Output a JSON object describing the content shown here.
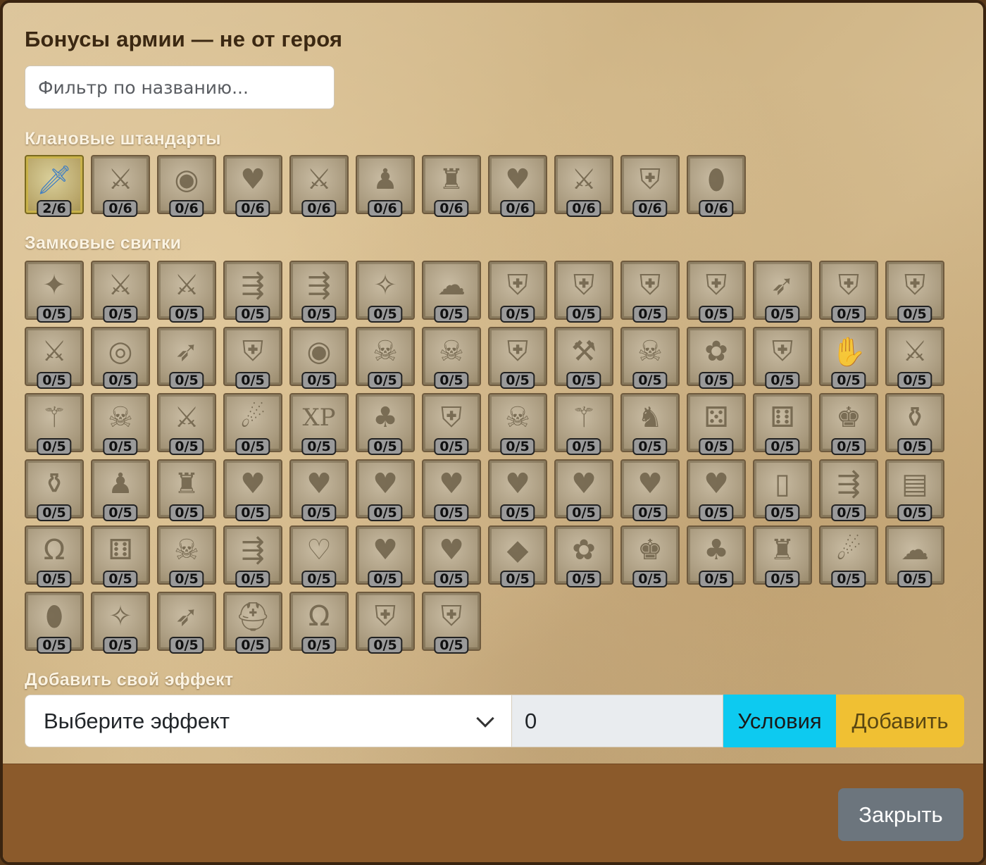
{
  "title": "Бонусы армии — не от героя",
  "filter": {
    "placeholder": "Фильтр по названию..."
  },
  "clan_section": {
    "title": "Клановые штандарты",
    "items": [
      {
        "icon": "sword-icon",
        "glyph": "🗡",
        "count": "2/6",
        "active": true
      },
      {
        "icon": "hand-sword-icon",
        "glyph": "⚔",
        "count": "0/6"
      },
      {
        "icon": "eye-icon",
        "glyph": "◉",
        "count": "0/6"
      },
      {
        "icon": "heart-sword-icon",
        "glyph": "♥",
        "count": "0/6"
      },
      {
        "icon": "crossed-swords-icon",
        "glyph": "⚔",
        "count": "0/6"
      },
      {
        "icon": "pawn-icon",
        "glyph": "♟",
        "count": "0/6"
      },
      {
        "icon": "tower-icon",
        "glyph": "♜",
        "count": "0/6"
      },
      {
        "icon": "heart-icon",
        "glyph": "♥",
        "count": "0/6"
      },
      {
        "icon": "sword-up-icon",
        "glyph": "⚔",
        "count": "0/6"
      },
      {
        "icon": "shield-up-icon",
        "glyph": "⛨",
        "count": "0/6"
      },
      {
        "icon": "egg-icon",
        "glyph": "⬮",
        "count": "0/6"
      }
    ]
  },
  "castle_section": {
    "title": "Замковые свитки",
    "items": [
      {
        "icon": "flock-icon",
        "glyph": "✦",
        "count": "0/5"
      },
      {
        "icon": "archer-icon",
        "glyph": "⚔",
        "count": "0/5"
      },
      {
        "icon": "blade-icon",
        "glyph": "⚔",
        "count": "0/5"
      },
      {
        "icon": "runner-icon",
        "glyph": "⇶",
        "count": "0/5"
      },
      {
        "icon": "soldier-icon",
        "glyph": "⇶",
        "count": "0/5"
      },
      {
        "icon": "wing-icon",
        "glyph": "✧",
        "count": "0/5"
      },
      {
        "icon": "cloud-icon",
        "glyph": "☁",
        "count": "0/5"
      },
      {
        "icon": "wing-shield-icon",
        "glyph": "⛨",
        "count": "0/5"
      },
      {
        "icon": "crowd-shield-icon",
        "glyph": "⛨",
        "count": "0/5"
      },
      {
        "icon": "fist-shield-icon",
        "glyph": "⛨",
        "count": "0/5"
      },
      {
        "icon": "star-shield-icon",
        "glyph": "⛨",
        "count": "0/5"
      },
      {
        "icon": "bow-icon",
        "glyph": "➶",
        "count": "0/5"
      },
      {
        "icon": "mage-shield-icon",
        "glyph": "⛨",
        "count": "0/5"
      },
      {
        "icon": "beast-shield-icon",
        "glyph": "⛨",
        "count": "0/5"
      },
      {
        "icon": "swords-arrows-icon",
        "glyph": "⚔",
        "count": "0/5"
      },
      {
        "icon": "ring-icon",
        "glyph": "◎",
        "count": "0/5"
      },
      {
        "icon": "bow-arrow-icon",
        "glyph": "➶",
        "count": "0/5"
      },
      {
        "icon": "shield-arrow-icon",
        "glyph": "⛨",
        "count": "0/5"
      },
      {
        "icon": "eye-plus-icon",
        "glyph": "◉",
        "count": "0/5"
      },
      {
        "icon": "skull-icon",
        "glyph": "☠",
        "count": "0/5"
      },
      {
        "icon": "skull-half-icon",
        "glyph": "☠",
        "count": "0/5"
      },
      {
        "icon": "chain-shield-icon",
        "glyph": "⛨",
        "count": "0/5"
      },
      {
        "icon": "axe-icon",
        "glyph": "⚒",
        "count": "0/5"
      },
      {
        "icon": "skull-dots-icon",
        "glyph": "☠",
        "count": "0/5"
      },
      {
        "icon": "flower-sword-icon",
        "glyph": "✿",
        "count": "0/5"
      },
      {
        "icon": "figure-shield-icon",
        "glyph": "⛨",
        "count": "0/5"
      },
      {
        "icon": "handshake-icon",
        "glyph": "✋",
        "count": "0/5"
      },
      {
        "icon": "sword-plus-icon",
        "glyph": "⚔",
        "count": "0/5"
      },
      {
        "icon": "wand-icon",
        "glyph": "⚚",
        "count": "0/5"
      },
      {
        "icon": "skull-run-icon",
        "glyph": "☠",
        "count": "0/5"
      },
      {
        "icon": "sword-hand-icon",
        "glyph": "⚔",
        "count": "0/5"
      },
      {
        "icon": "fire-ring-icon",
        "glyph": "☄",
        "count": "0/5"
      },
      {
        "icon": "xp-icon",
        "glyph": "XP",
        "count": "0/5"
      },
      {
        "icon": "tree-icon",
        "glyph": "♣",
        "count": "0/5"
      },
      {
        "icon": "splash-shield-icon",
        "glyph": "⛨",
        "count": "0/5"
      },
      {
        "icon": "skull-split-icon",
        "glyph": "☠",
        "count": "0/5"
      },
      {
        "icon": "staff-icon",
        "glyph": "⚚",
        "count": "0/5"
      },
      {
        "icon": "horse-icon",
        "glyph": "♞",
        "count": "0/5"
      },
      {
        "icon": "dice-icon",
        "glyph": "⚄",
        "count": "0/5"
      },
      {
        "icon": "dice-cloud-icon",
        "glyph": "⚅",
        "count": "0/5"
      },
      {
        "icon": "warrior-icon",
        "glyph": "♚",
        "count": "0/5"
      },
      {
        "icon": "potion-icon",
        "glyph": "⚱",
        "count": "0/5"
      },
      {
        "icon": "flask-icon",
        "glyph": "⚱",
        "count": "0/5"
      },
      {
        "icon": "pawn-small-icon",
        "glyph": "♟",
        "count": "0/5"
      },
      {
        "icon": "tower-small-icon",
        "glyph": "♜",
        "count": "0/5"
      },
      {
        "icon": "potion-heart-icon",
        "glyph": "♥",
        "count": "0/5"
      },
      {
        "icon": "feather-heart-icon",
        "glyph": "♥",
        "count": "0/5"
      },
      {
        "icon": "staff-heart-icon",
        "glyph": "♥",
        "count": "0/5"
      },
      {
        "icon": "pig-heart-icon",
        "glyph": "♥",
        "count": "0/5"
      },
      {
        "icon": "cloud-heart-icon",
        "glyph": "♥",
        "count": "0/5"
      },
      {
        "icon": "sword-heart-icon",
        "glyph": "♥",
        "count": "0/5"
      },
      {
        "icon": "helmet-heart-icon",
        "glyph": "♥",
        "count": "0/5"
      },
      {
        "icon": "horseshoe-heart-icon",
        "glyph": "♥",
        "count": "0/5"
      },
      {
        "icon": "door-icon",
        "glyph": "▯",
        "count": "0/5"
      },
      {
        "icon": "helmet-arrow-icon",
        "glyph": "⇶",
        "count": "0/5"
      },
      {
        "icon": "stairs-icon",
        "glyph": "▤",
        "count": "0/5"
      },
      {
        "icon": "horseshoe-arrow-icon",
        "glyph": "Ω",
        "count": "0/5"
      },
      {
        "icon": "dice-mage-icon",
        "glyph": "⚅",
        "count": "0/5"
      },
      {
        "icon": "skull-horn-icon",
        "glyph": "☠",
        "count": "0/5"
      },
      {
        "icon": "mage-run-icon",
        "glyph": "⇶",
        "count": "0/5"
      },
      {
        "icon": "heart-outline-icon",
        "glyph": "♡",
        "count": "0/5"
      },
      {
        "icon": "wand-heart-icon",
        "glyph": "♥",
        "count": "0/5"
      },
      {
        "icon": "creature-heart-icon",
        "glyph": "♥",
        "count": "0/5"
      },
      {
        "icon": "crystal-icon",
        "glyph": "◆",
        "count": "0/5"
      },
      {
        "icon": "flower-bowl-icon",
        "glyph": "✿",
        "count": "0/5"
      },
      {
        "icon": "hooded-bowl-icon",
        "glyph": "♚",
        "count": "0/5"
      },
      {
        "icon": "tree-bowl-icon",
        "glyph": "♣",
        "count": "0/5"
      },
      {
        "icon": "tower-bowl-icon",
        "glyph": "♜",
        "count": "0/5"
      },
      {
        "icon": "fire-bowl-icon",
        "glyph": "☄",
        "count": "0/5"
      },
      {
        "icon": "cloud-bowl-icon",
        "glyph": "☁",
        "count": "0/5"
      },
      {
        "icon": "wing-egg-icon",
        "glyph": "⬮",
        "count": "0/5"
      },
      {
        "icon": "feathers-icon",
        "glyph": "✧",
        "count": "0/5"
      },
      {
        "icon": "bow-swing-icon",
        "glyph": "➶",
        "count": "0/5"
      },
      {
        "icon": "helmet-icon",
        "glyph": "⛑",
        "count": "0/5"
      },
      {
        "icon": "horseshoe-icon",
        "glyph": "Ω",
        "count": "0/5"
      },
      {
        "icon": "shield-icon",
        "glyph": "⛨",
        "count": "0/5"
      },
      {
        "icon": "wand-shield-icon",
        "glyph": "⛨",
        "count": "0/5"
      }
    ]
  },
  "custom_effect": {
    "title": "Добавить свой эффект",
    "select_value": "Выберите эффект",
    "amount_value": "0",
    "conditions_label": "Условия",
    "add_label": "Добавить"
  },
  "footer": {
    "close_label": "Закрыть"
  },
  "colors": {
    "conditions_button": "#0dcaf0",
    "add_button": "#f0c033",
    "close_button": "#6c757d",
    "footer": "#8b5a2b"
  }
}
